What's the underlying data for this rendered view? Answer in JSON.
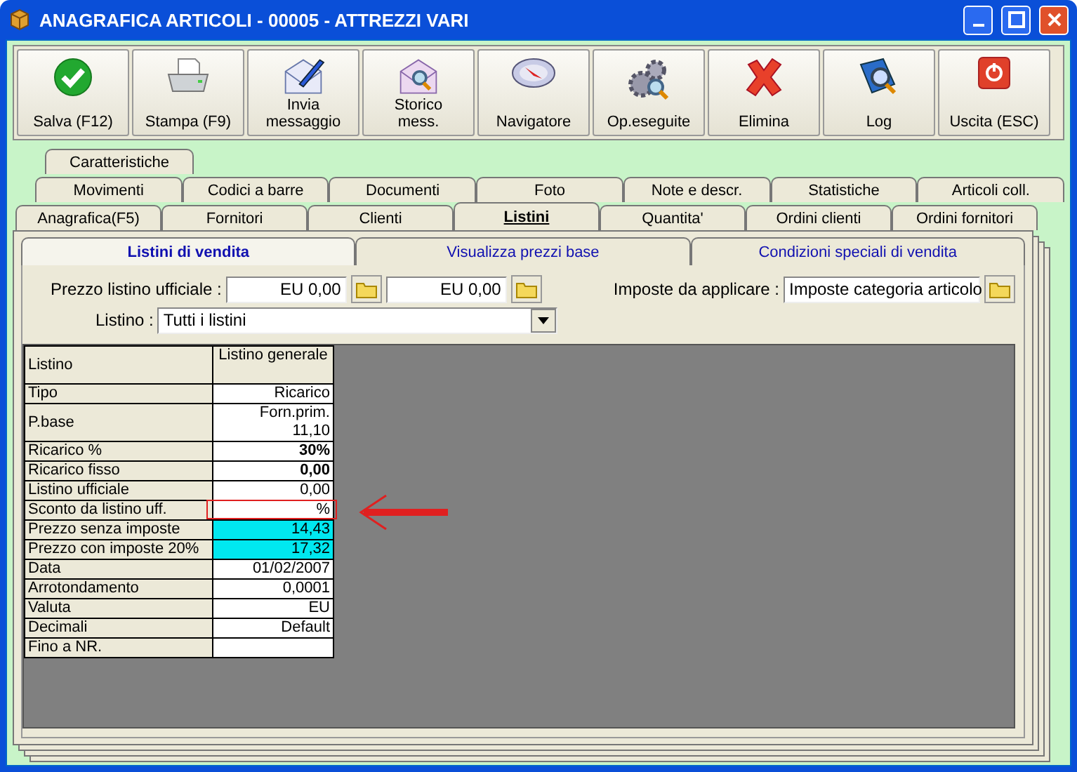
{
  "window": {
    "title": "ANAGRAFICA ARTICOLI - 00005 - ATTREZZI VARI"
  },
  "toolbar": [
    {
      "label": "Salva (F12)",
      "kind": "check"
    },
    {
      "label": "Stampa (F9)",
      "kind": "printer"
    },
    {
      "label": "Invia messaggio",
      "kind": "send"
    },
    {
      "label": "Storico mess.",
      "kind": "history"
    },
    {
      "label": "Navigatore",
      "kind": "compass"
    },
    {
      "label": "Op.eseguite",
      "kind": "gears"
    },
    {
      "label": "Elimina",
      "kind": "delete"
    },
    {
      "label": "Log",
      "kind": "log"
    },
    {
      "label": "Uscita (ESC)",
      "kind": "exit"
    }
  ],
  "tab_rows": [
    [
      {
        "label": "Caratteristiche",
        "selected": false
      }
    ],
    [
      {
        "label": "Movimenti",
        "selected": false
      },
      {
        "label": "Codici a barre",
        "selected": false
      },
      {
        "label": "Documenti",
        "selected": false
      },
      {
        "label": "Foto",
        "selected": false
      },
      {
        "label": "Note e descr.",
        "selected": false
      },
      {
        "label": "Statistiche",
        "selected": false
      },
      {
        "label": "Articoli coll.",
        "selected": false
      }
    ],
    [
      {
        "label": "Anagrafica(F5)",
        "selected": false
      },
      {
        "label": "Fornitori",
        "selected": false
      },
      {
        "label": "Clienti",
        "selected": false
      },
      {
        "label": "Listini",
        "selected": true
      },
      {
        "label": "Quantita'",
        "selected": false
      },
      {
        "label": "Ordini clienti",
        "selected": false
      },
      {
        "label": "Ordini fornitori",
        "selected": false
      }
    ]
  ],
  "subtabs": [
    {
      "label": "Listini di vendita",
      "selected": true
    },
    {
      "label": "Visualizza prezzi base",
      "selected": false
    },
    {
      "label": "Condizioni speciali di vendita",
      "selected": false
    }
  ],
  "form": {
    "prezzo_label": "Prezzo listino ufficiale :",
    "prezzo_values": [
      "EU 0,00",
      "EU 0,00"
    ],
    "imposte_label": "Imposte da applicare :",
    "imposte_value": "Imposte categoria articolo",
    "listino_label": "Listino :",
    "listino_value": "Tutti i listini"
  },
  "table": {
    "columns": [
      "Listino",
      "Listino generale"
    ],
    "rows": [
      {
        "label": "Tipo",
        "lines": [
          "Ricarico"
        ],
        "bold": false,
        "highlighted": false,
        "marked": false
      },
      {
        "label": "P.base",
        "lines": [
          "Forn.prim.",
          "11,10"
        ],
        "bold": false,
        "highlighted": false,
        "marked": false
      },
      {
        "label": "Ricarico %",
        "lines": [
          "30%"
        ],
        "bold": true,
        "highlighted": false,
        "marked": false
      },
      {
        "label": "Ricarico fisso",
        "lines": [
          "0,00"
        ],
        "bold": true,
        "highlighted": false,
        "marked": false
      },
      {
        "label": "Listino ufficiale",
        "lines": [
          "0,00"
        ],
        "bold": false,
        "highlighted": false,
        "marked": false
      },
      {
        "label": "Sconto da listino uff.",
        "lines": [
          "%"
        ],
        "bold": false,
        "highlighted": false,
        "marked": true
      },
      {
        "label": "Prezzo senza imposte",
        "lines": [
          "14,43"
        ],
        "bold": false,
        "highlighted": true,
        "marked": false
      },
      {
        "label": "Prezzo con imposte 20%",
        "lines": [
          "17,32"
        ],
        "bold": false,
        "highlighted": true,
        "marked": false
      },
      {
        "label": "Data",
        "lines": [
          "01/02/2007"
        ],
        "bold": false,
        "highlighted": false,
        "marked": false
      },
      {
        "label": "Arrotondamento",
        "lines": [
          "0,0001"
        ],
        "bold": false,
        "highlighted": false,
        "marked": false
      },
      {
        "label": "Valuta",
        "lines": [
          "EU"
        ],
        "bold": false,
        "highlighted": false,
        "marked": false
      },
      {
        "label": "Decimali",
        "lines": [
          "Default"
        ],
        "bold": false,
        "highlighted": false,
        "marked": false
      },
      {
        "label": "Fino a NR.",
        "highlighted": false,
        "marked": false
      }
    ]
  }
}
